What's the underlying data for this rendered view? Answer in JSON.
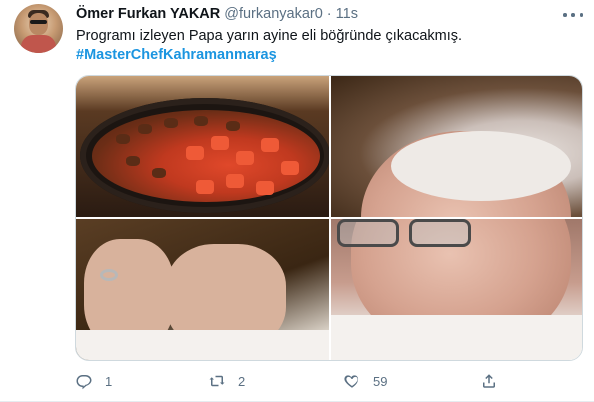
{
  "tweet": {
    "display_name": "Ömer Furkan YAKAR",
    "handle": "@furkanyakar0",
    "separator": "·",
    "time": "11s",
    "text": "Programı izleyen Papa yarın ayine eli böğründe çıkacakmış.",
    "hashtag": "#MasterChefKahramanmaraş"
  },
  "media": {
    "tiles": [
      "food-photo",
      "pope-photo",
      "hands-photo",
      "pope-photo"
    ]
  },
  "actions": {
    "reply_count": "1",
    "retweet_count": "2",
    "like_count": "59",
    "share_count": ""
  },
  "icons": {
    "more": "more-horizontal-icon",
    "reply": "reply-icon",
    "retweet": "retweet-icon",
    "like": "heart-icon",
    "share": "share-icon"
  },
  "colors": {
    "text": "#0f1419",
    "muted": "#5b7083",
    "link": "#1b95e0",
    "border": "#e6ecf0"
  }
}
